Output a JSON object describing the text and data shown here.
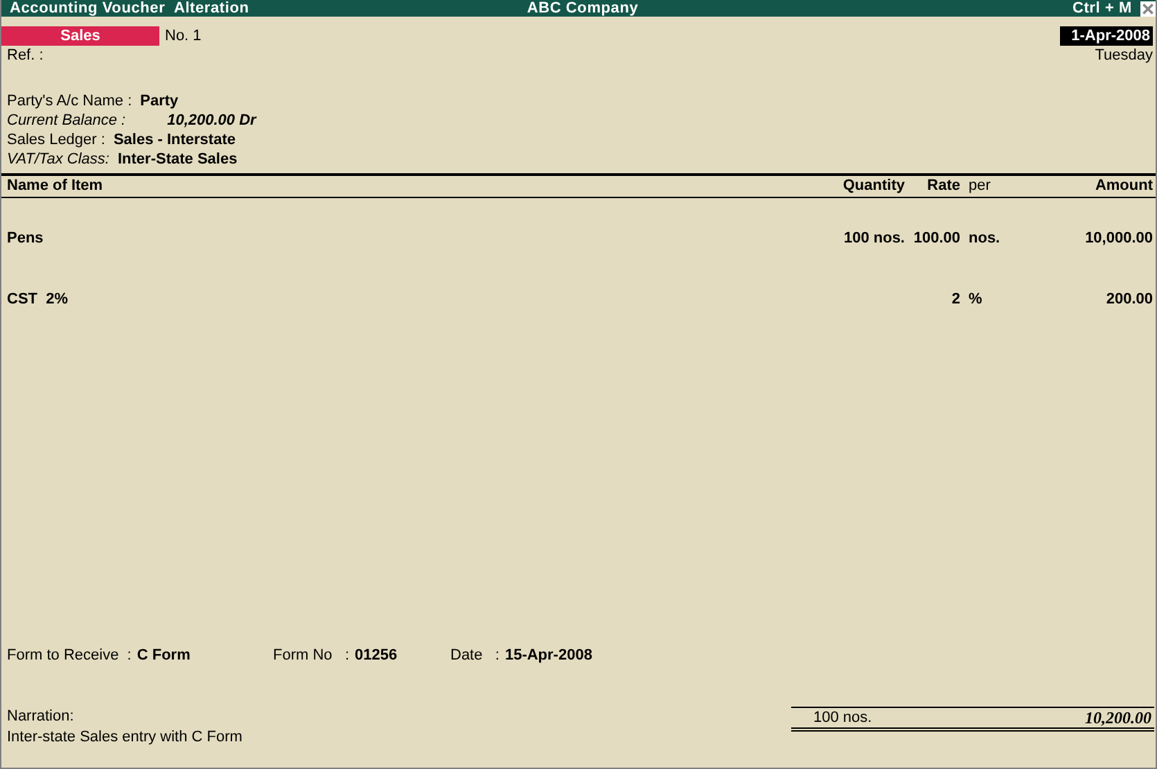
{
  "window": {
    "title": "Accounting Voucher  Alteration",
    "company": "ABC Company",
    "shortcut": "Ctrl + M"
  },
  "voucher": {
    "type": "Sales",
    "number": "No. 1",
    "date": "1-Apr-2008",
    "weekday": "Tuesday",
    "ref_label": "Ref. :"
  },
  "party_fields": [
    {
      "label": "Party's A/c Name :",
      "value": "Party",
      "italic": false
    },
    {
      "label": "Current Balance :",
      "value": "10,200.00 Dr",
      "italic": true
    },
    {
      "label": "Sales Ledger :",
      "value": "Sales - Interstate",
      "italic": false
    },
    {
      "label": "VAT/Tax Class:",
      "value": "Inter-State Sales",
      "italic": true
    }
  ],
  "table": {
    "columns": [
      "Name of Item",
      "Quantity",
      "Rate",
      "per",
      "Amount"
    ],
    "rows": [
      {
        "name": "Pens",
        "quantity": "100 nos.",
        "rate": "100.00",
        "per": "nos.",
        "amount": "10,000.00"
      },
      {
        "name": "CST  2%",
        "rate": "2",
        "per": "%",
        "amount": "200.00"
      }
    ]
  },
  "form_fields": [
    {
      "label": "Form to Receive  :",
      "value": "C Form"
    },
    {
      "label": "Form No   :",
      "value": "01256"
    },
    {
      "label": "Date   :",
      "value": "15-Apr-2008"
    }
  ],
  "narration": {
    "label": "Narration:",
    "text": "Inter-state Sales entry with C Form"
  },
  "totals": {
    "quantity": "100 nos.",
    "amount": "10,200.00"
  }
}
